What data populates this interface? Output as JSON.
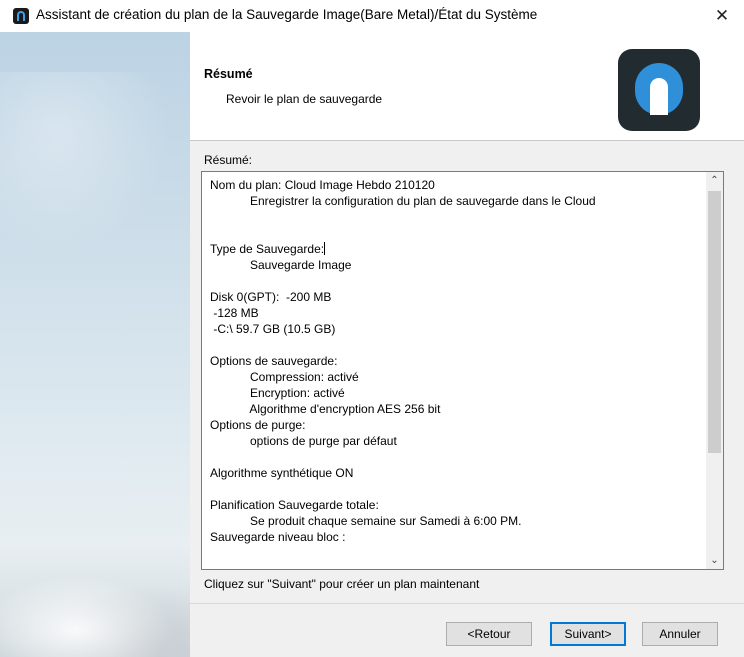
{
  "window": {
    "title": "Assistant de création du plan de la Sauvegarde Image(Bare Metal)/État du Système",
    "close_glyph": "✕"
  },
  "header": {
    "heading": "Résumé",
    "subheading": "Revoir le plan de sauvegarde"
  },
  "summary": {
    "label": "Résumé:",
    "lines": [
      "Nom du plan: Cloud Image Hebdo 210120",
      "            Enregistrer la configuration du plan de sauvegarde dans le Cloud",
      "",
      "",
      "Type de Sauvegarde:",
      "            Sauvegarde Image",
      "",
      "Disk 0(GPT):  -200 MB",
      " -128 MB",
      " -C:\\ 59.7 GB (10.5 GB)",
      "",
      "Options de sauvegarde:",
      "            Compression: activé",
      "            Encryption: activé",
      "            Algorithme d'encryption AES 256 bit",
      "Options de purge:",
      "            options de purge par défaut",
      "",
      "Algorithme synthétique ON",
      "",
      "Planification Sauvegarde totale:",
      "            Se produit chaque semaine sur Samedi à 6:00 PM.",
      "Sauvegarde niveau bloc :"
    ]
  },
  "scroll": {
    "up_glyph": "⌃",
    "down_glyph": "⌄"
  },
  "hint": "Cliquez sur \"Suivant\" pour créer un plan maintenant",
  "buttons": {
    "back": "<Retour",
    "next": "Suivant>",
    "cancel": "Annuler"
  },
  "colors": {
    "accent": "#0078d7",
    "logo_blue": "#2f8fd9",
    "logo_bg": "#222b2f"
  },
  "icons": {
    "app": "msp360-logo-icon",
    "close": "close-icon"
  }
}
